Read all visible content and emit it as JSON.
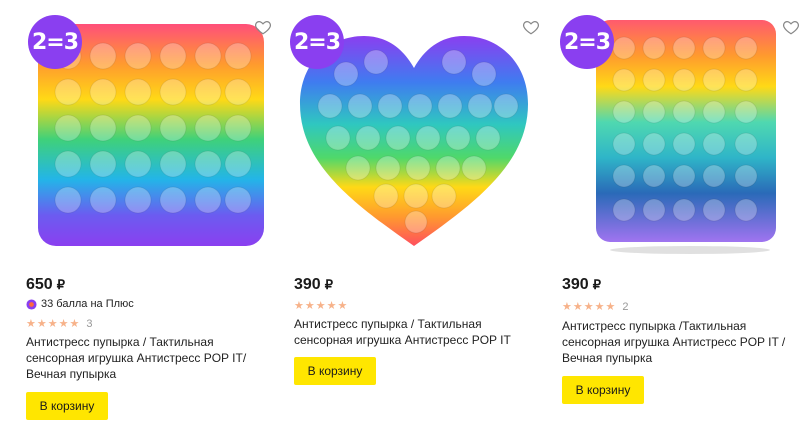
{
  "products": [
    {
      "badge": "2=3",
      "image": "rainbow-square-pop-it",
      "price": "650",
      "currency": "₽",
      "points": "33 балла на Плюс",
      "stars": 5,
      "reviews": "3",
      "title": "Антистресс пупырка / Тактильная сенсорная игрушка Антистресс POP IT/ Вечная пупырка",
      "cart_label": "В корзину"
    },
    {
      "badge": "2=3",
      "image": "rainbow-heart-pop-it",
      "price": "390",
      "currency": "₽",
      "stars": 5,
      "reviews": "",
      "title": "Антистресс пупырка / Тактильная сенсорная игрушка Антистресс POP IT",
      "cart_label": "В корзину"
    },
    {
      "badge": "2=3",
      "image": "rainbow-square-pop-it",
      "price": "390",
      "currency": "₽",
      "stars": 5,
      "reviews": "2",
      "title": "Антистресс пупырка /Тактильная сенсорная игрушка Антистресс POP IT / Вечная пупырка",
      "cart_label": "В корзину"
    }
  ],
  "colors": {
    "badge": "#8a3ff0",
    "cart_button": "#ffe600",
    "star": "#f7b28a"
  }
}
